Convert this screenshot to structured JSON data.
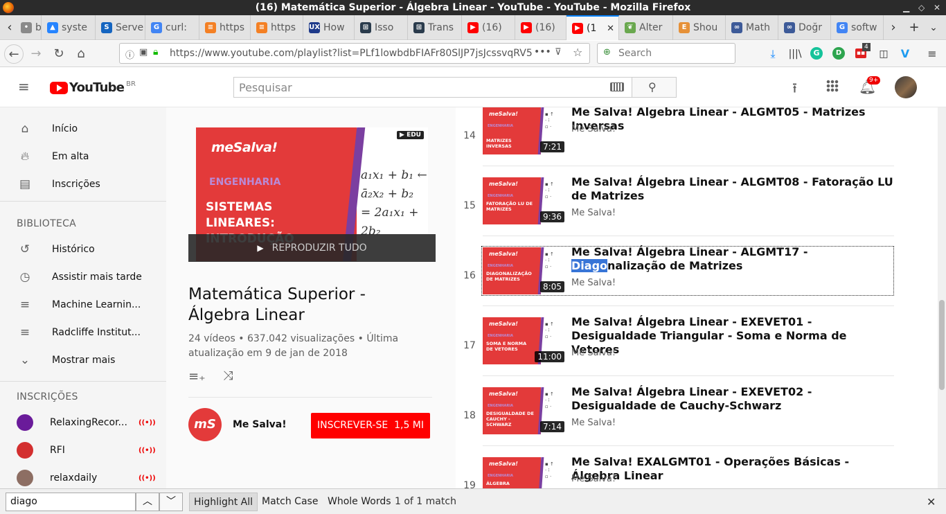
{
  "window": {
    "title": "(16) Matemática Superior - Álgebra Linear - YouTube - YouTube - Mozilla Firefox"
  },
  "tabs": [
    {
      "label": "bo",
      "icon": "generic-icon",
      "color": "#8a8a8a"
    },
    {
      "label": "syste",
      "icon": "atlassian-icon",
      "color": "#2684ff"
    },
    {
      "label": "Serve",
      "icon": "server-icon",
      "color": "#1565c0"
    },
    {
      "label": "curl:",
      "icon": "google-icon",
      "color": "#4285f4"
    },
    {
      "label": "https",
      "icon": "stack-icon",
      "color": "#f48024"
    },
    {
      "label": "https",
      "icon": "stack-icon",
      "color": "#f48024"
    },
    {
      "label": "How",
      "icon": "ux-icon",
      "color": "#1e3a8a"
    },
    {
      "label": "Isso",
      "icon": "meta-icon",
      "color": "#2a3b4c"
    },
    {
      "label": "Trans",
      "icon": "meta-icon",
      "color": "#2a3b4c"
    },
    {
      "label": "(16)",
      "icon": "youtube-icon",
      "color": "#ff0000"
    },
    {
      "label": "(16)",
      "icon": "youtube-icon",
      "color": "#ff0000"
    },
    {
      "label": "(1",
      "icon": "youtube-icon",
      "color": "#ff0000",
      "active": true
    },
    {
      "label": "Alter",
      "icon": "leaf-icon",
      "color": "#6aa84f"
    },
    {
      "label": "Shou",
      "icon": "e-icon",
      "color": "#e69138"
    },
    {
      "label": "Math",
      "icon": "link-icon",
      "color": "#3d5a98"
    },
    {
      "label": "Doğr",
      "icon": "link-icon",
      "color": "#3d5a98"
    },
    {
      "label": "softw",
      "icon": "google-icon",
      "color": "#4285f4"
    }
  ],
  "nav": {
    "url": "https://www.youtube.com/playlist?list=PLf1lowbdbFIAFr80SlJP7jsJcssvqRV5",
    "search_placeholder": "Search",
    "notif_count": "4"
  },
  "youtube": {
    "logo_text": "YouTube",
    "region": "BR",
    "search_placeholder": "Pesquisar",
    "bell_badge": "9+"
  },
  "sidebar": {
    "main": [
      {
        "label": "Início",
        "icon": "home-icon"
      },
      {
        "label": "Em alta",
        "icon": "flame-icon"
      },
      {
        "label": "Inscrições",
        "icon": "subscriptions-icon"
      }
    ],
    "library_header": "BIBLIOTECA",
    "library": [
      {
        "label": "Histórico",
        "icon": "history-icon"
      },
      {
        "label": "Assistir mais tarde",
        "icon": "clock-icon"
      },
      {
        "label": "Machine Learnin...",
        "icon": "playlist-icon"
      },
      {
        "label": "Radcliffe Institut...",
        "icon": "playlist-icon"
      },
      {
        "label": "Mostrar mais",
        "icon": "chevron-down-icon"
      }
    ],
    "subs_header": "INSCRIÇÕES",
    "subs": [
      {
        "label": "RelaxingRecor...",
        "color": "#6a1b9a"
      },
      {
        "label": "RFI",
        "color": "#d32f2f"
      },
      {
        "label": "relaxdaily",
        "color": "#8d6e63"
      }
    ]
  },
  "playlist": {
    "thumb_brand": "meSalva!",
    "thumb_category": "ENGENHARIA",
    "thumb_title": "SISTEMAS LINEARES: INTRODUÇÃO",
    "thumb_badge": "EDU",
    "play_all": "REPRODUZIR TUDO",
    "title": "Matemática Superior - Álgebra Linear",
    "videos": "24 vídeos",
    "views": "637.042 visualizações",
    "updated": "Última atualização em 9 de jan de 2018",
    "channel": "Me Salva!",
    "subscribe_label": "INSCREVER-SE",
    "subscribe_count": "1,5 MI"
  },
  "videos": [
    {
      "index": "14",
      "title": "Me Salva! Álgebra Linear - ALGMT05 - Matrizes Inversas",
      "channel": "Me Salva!",
      "duration": "7:21",
      "thumb_title": "MATRIZES INVERSAS"
    },
    {
      "index": "15",
      "title": "Me Salva! Álgebra Linear - ALGMT08 - Fatoração LU de Matrizes",
      "channel": "Me Salva!",
      "duration": "9:36",
      "thumb_title": "FATORAÇÃO LU DE MATRIZES"
    },
    {
      "index": "16",
      "title_pre": "Me Salva! Álgebra Linear - ALGMT17 - ",
      "title_hl": "Diago",
      "title_post": "nalização de Matrizes",
      "channel": "Me Salva!",
      "duration": "8:05",
      "thumb_title": "DIAGONALIZAÇÃO DE MATRIZES"
    },
    {
      "index": "17",
      "title": "Me Salva! Álgebra Linear - EXEVET01 - Desigualdade Triangular - Soma e Norma de Vetores",
      "channel": "Me Salva!",
      "duration": "11:00",
      "thumb_title": "SOMA E NORMA DE VETORES"
    },
    {
      "index": "18",
      "title": "Me Salva! Álgebra Linear - EXEVET02 - Desigualdade de Cauchy-Schwarz",
      "channel": "Me Salva!",
      "duration": "7:14",
      "thumb_title": "DESIGUALDADE DE CAUCHY - SCHWARZ"
    },
    {
      "index": "19",
      "title": "Me Salva! EXALGMT01 - Operações Básicas - Álgebra Linear",
      "channel": "Me Salva!",
      "duration": "",
      "thumb_title": "ÁLGEBRA"
    }
  ],
  "findbar": {
    "query": "diago",
    "highlight_all": "Highlight All",
    "match_case": "Match Case",
    "whole_words": "Whole Words",
    "result": "1 of 1 match"
  }
}
